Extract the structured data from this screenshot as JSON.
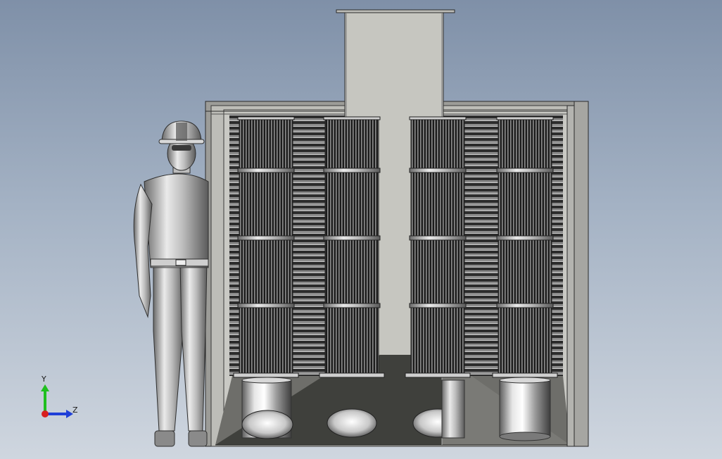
{
  "viewport": {
    "background_top": "#7f90a8",
    "background_bottom": "#cfd6df"
  },
  "model": {
    "filter_cartridge_count": 4,
    "cartridge_band_count": 4,
    "hopper_outlet_count": 4,
    "figure": "worker-with-hard-hat"
  },
  "triad": {
    "y_label": "Y",
    "z_label": "Z",
    "y_color": "#1fbf1f",
    "z_color": "#1f3fd8",
    "x_color": "#d81f1f"
  }
}
